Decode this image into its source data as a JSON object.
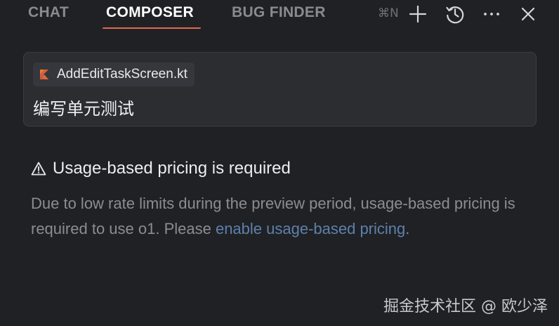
{
  "tabs": [
    {
      "label": "CHAT",
      "active": false
    },
    {
      "label": "COMPOSER",
      "active": true
    },
    {
      "label": "BUG FINDER",
      "active": false
    }
  ],
  "toolbar": {
    "shortcut": "⌘N",
    "icons": [
      "plus-icon",
      "history-icon",
      "more-icon",
      "close-icon"
    ]
  },
  "composer": {
    "file_chip": {
      "icon": "kotlin-icon",
      "label": "AddEditTaskScreen.kt"
    },
    "prompt": "编写单元测试"
  },
  "warning": {
    "icon": "warning-triangle-icon",
    "title": "Usage-based pricing is required",
    "body_prefix": "Due to low rate limits during the preview period, usage-based pricing is required to use o1. Please ",
    "link_text": "enable usage-based pricing",
    "body_suffix": "."
  },
  "watermark": "掘金技术社区 @ 欧少泽",
  "colors": {
    "background": "#202125",
    "accent": "#e0694f",
    "link": "#5e80ab",
    "card": "#2c2d31"
  }
}
